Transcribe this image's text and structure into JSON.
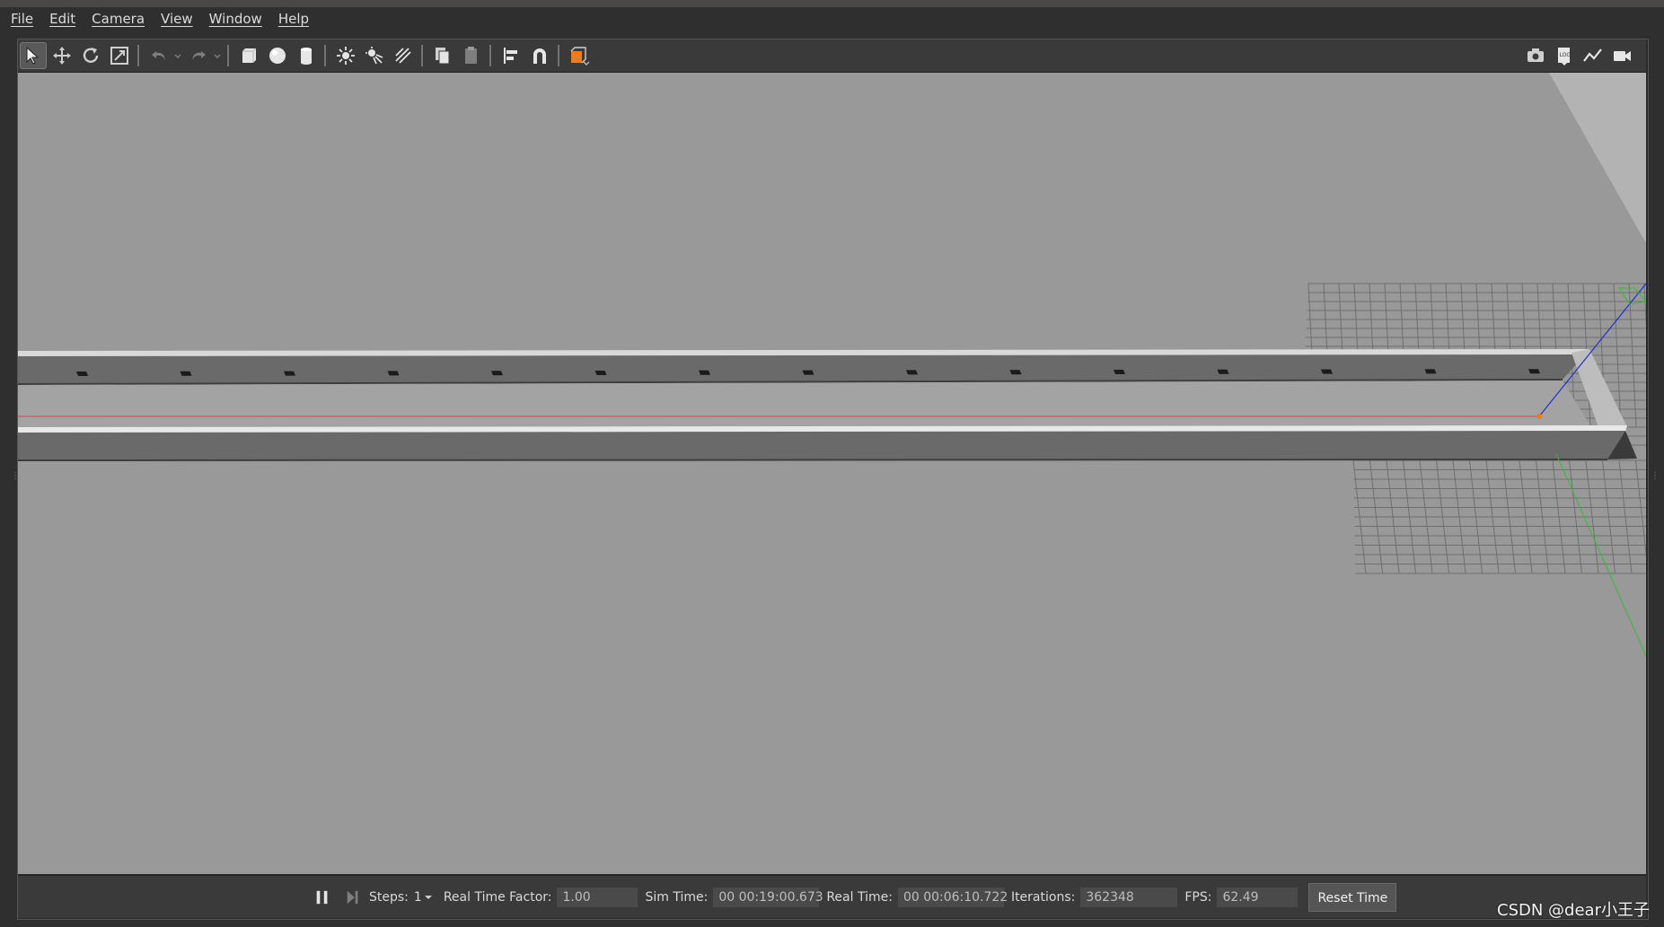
{
  "menu": {
    "items": [
      {
        "label": "File"
      },
      {
        "label": "Edit"
      },
      {
        "label": "Camera"
      },
      {
        "label": "View"
      },
      {
        "label": "Window"
      },
      {
        "label": "Help"
      }
    ]
  },
  "toolbar": {
    "left_icons": [
      "select-arrow-icon",
      "translate-icon",
      "rotate-icon",
      "scale-icon",
      "undo-icon",
      "redo-icon",
      "box-icon",
      "sphere-icon",
      "cylinder-icon",
      "point-light-icon",
      "spot-light-icon",
      "directional-light-icon",
      "copy-icon",
      "paste-icon",
      "align-icon",
      "snap-icon",
      "change-view-icon"
    ],
    "right_icons": [
      "screenshot-icon",
      "log-icon",
      "plot-icon",
      "record-icon"
    ]
  },
  "status": {
    "steps_label": "Steps:",
    "steps_value": "1",
    "rtf_label": "Real Time Factor:",
    "rtf_value": "1.00",
    "sim_time_label": "Sim Time:",
    "sim_time_value": "00 00:19:00.673",
    "real_time_label": "Real Time:",
    "real_time_value": "00 00:06:10.722",
    "iterations_label": "Iterations:",
    "iterations_value": "362348",
    "fps_label": "FPS:",
    "fps_value": "62.49",
    "reset_label": "Reset Time"
  },
  "watermark": "CSDN @dear小王子",
  "colors": {
    "viewport_bg": "#999999",
    "toolbar_bg": "#3a3a3a",
    "accent_orange": "#f07b1a",
    "x_axis": "#d03030",
    "y_axis": "#2fbf2f",
    "z_axis": "#2030d0"
  }
}
